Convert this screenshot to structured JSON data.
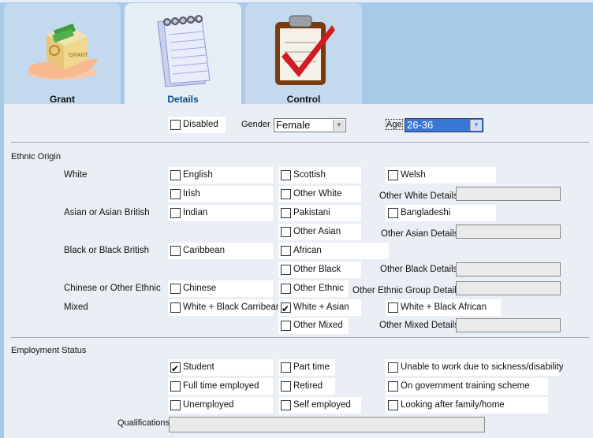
{
  "tabs": [
    {
      "label": "Grant",
      "icon": "grant-box-icon"
    },
    {
      "label": "Details",
      "icon": "notepad-icon"
    },
    {
      "label": "Control",
      "icon": "clipboard-check-icon"
    }
  ],
  "top": {
    "disabled": "Disabled",
    "gender_label": "Gender",
    "gender_value": "Female",
    "age_label": "Age",
    "age_value": "26-36"
  },
  "ethnic": {
    "section": "Ethnic Origin",
    "white": "White",
    "asian": "Asian or Asian British",
    "black": "Black or Black British",
    "chinese": "Chinese or Other Ethnic",
    "mixed": "Mixed",
    "english": "English",
    "scottish": "Scottish",
    "welsh": "Welsh",
    "irish": "Irish",
    "other_white": "Other White",
    "other_white_details": "Other White Details",
    "indian": "Indian",
    "pakistani": "Pakistani",
    "bangladeshi": "Bangladeshi",
    "other_asian": "Other Asian",
    "other_asian_details": "Other Asian Details",
    "caribbean": "Caribbean",
    "african": "African",
    "other_black": "Other Black",
    "other_black_details": "Other Black Details",
    "chinese_cb": "Chinese",
    "other_ethnic": "Other Ethnic",
    "other_ethnic_details": "Other Ethnic Group Details",
    "white_black_carribean": "White + Black Carribean",
    "white_asian": "White + Asian",
    "white_black_african": "White + Black African",
    "other_mixed": "Other Mixed",
    "other_mixed_details": "Other Mixed Details"
  },
  "employment": {
    "section": "Employment Status",
    "student": "Student",
    "part_time": "Part time",
    "unable": "Unable to work due to sickness/disability",
    "full_time": "Full time employed",
    "retired": "Retired",
    "training": "On government training scheme",
    "unemployed": "Unemployed",
    "self_employed": "Self employed",
    "family": "Looking after family/home",
    "qualifications": "Qualifications"
  }
}
